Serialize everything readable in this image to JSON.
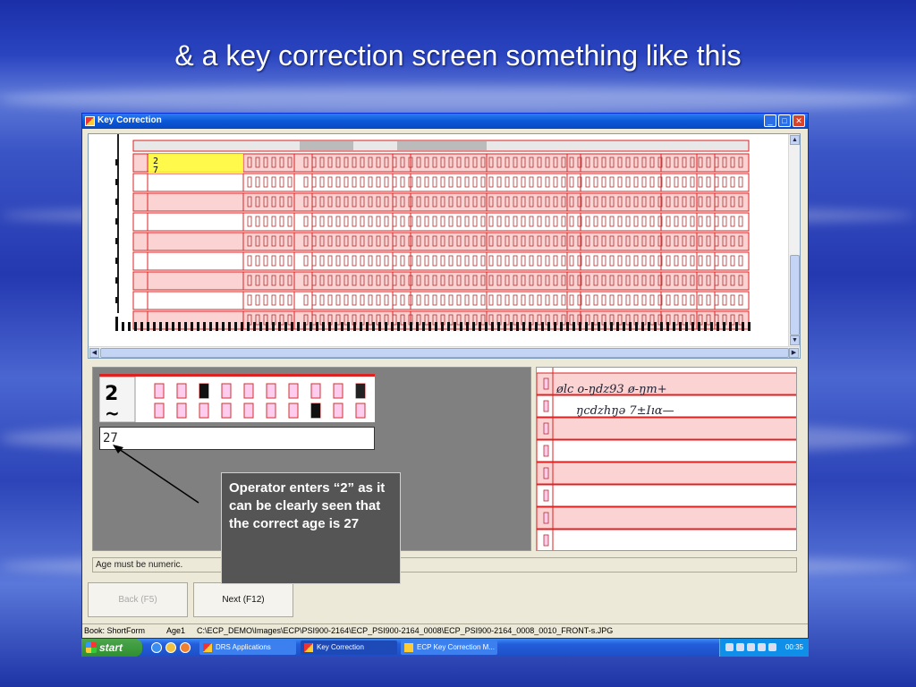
{
  "slide": {
    "title": "&  a key correction screen something like this"
  },
  "window": {
    "title": "Key Correction",
    "minimize": "_",
    "restore": "□",
    "close": "✕"
  },
  "entry_value": "27",
  "status_message": "Age must be numeric.",
  "buttons": {
    "back": "Back (F5)",
    "next": "Next (F12)"
  },
  "info_bar": {
    "book": "Book: ShortForm",
    "field": "Age1",
    "path": "C:\\ECP_DEMO\\Images\\ECP\\PSI900-2164\\ECP_PSI900-2164_0008\\ECP_PSI900-2164_0008_0010_FRONT-s.JPG"
  },
  "taskbar": {
    "start": "start",
    "tasks": [
      "DRS Applications",
      "Key Correction",
      "ECP Key Correction M..."
    ],
    "clock": "00:35"
  },
  "callout": "Operator enters “2” as it can be clearly seen that the correct age is 27",
  "handwriting": [
    "ølc  o-ŋǳ93   ø-ŋm+",
    "ŋcǳhŋə   7±Iıɑ—"
  ],
  "colors": {
    "accent": "#0a58d8",
    "highlight": "#ffff33",
    "form_red": "#d22222"
  }
}
